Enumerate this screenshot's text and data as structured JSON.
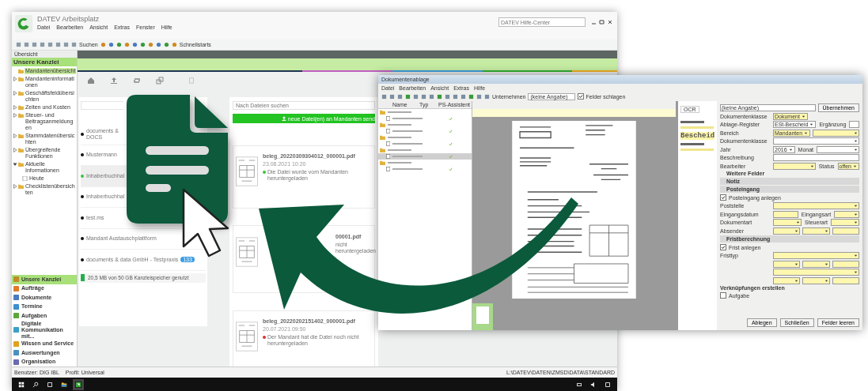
{
  "back_window": {
    "title": "DATEV Arbeitsplatz",
    "menu": [
      "Datei",
      "Bearbeiten",
      "Ansicht",
      "Extras",
      "Fenster",
      "Hilfe"
    ],
    "toolbar": {
      "search_label": "Suchen",
      "quick_label": "Schnellstarts"
    },
    "help_search": {
      "placeholder": "DATEV Hilfe-Center"
    },
    "sidebar": {
      "header": "Übersicht",
      "section": "Unsere Kanzlei",
      "tree": [
        {
          "label": "Mandantenübersicht",
          "selected": true
        },
        {
          "label": "Mandanteninformationen",
          "selected": false,
          "expanded": false
        },
        {
          "label": "Geschäftsfeldübersichten",
          "selected": false,
          "expanded": false
        },
        {
          "label": "Zeiten und Kosten",
          "selected": false,
          "expanded": false
        },
        {
          "label": "Steuer- und Beitragsanmeldungen",
          "selected": false,
          "expanded": false
        },
        {
          "label": "Stammdatenübersichten",
          "selected": false,
          "expanded": false
        },
        {
          "label": "Übergreifende Funktionen",
          "selected": false,
          "expanded": false
        },
        {
          "label": "Aktuelle Informationen",
          "selected": false,
          "expanded": true,
          "children": [
            {
              "label": "Heute",
              "selected": false
            }
          ]
        },
        {
          "label": "Checklistenübersichten",
          "selected": false,
          "expanded": false
        }
      ],
      "nav": [
        {
          "label": "Unsere Kanzlei",
          "selected": true,
          "color": "#c08a2a"
        },
        {
          "label": "Aufträge",
          "selected": false,
          "color": "#e07b2a"
        },
        {
          "label": "Dokumente",
          "selected": false,
          "color": "#4a7bbf"
        },
        {
          "label": "Termine",
          "selected": false,
          "color": "#3c8fd0"
        },
        {
          "label": "Aufgaben",
          "selected": false,
          "color": "#5aa83c"
        },
        {
          "label": "Digitale Kommunikation mit...",
          "selected": false,
          "color": "#3aa0c8"
        },
        {
          "label": "Wissen und Service",
          "selected": false,
          "color": "#e0a020"
        },
        {
          "label": "Auswertungen",
          "selected": false,
          "color": "#4a90c0"
        },
        {
          "label": "Organisation",
          "selected": false,
          "color": "#6a6ab0"
        }
      ]
    },
    "portal": {
      "clients": [
        {
          "name": "documents &",
          "sub": "DOCS",
          "selected": false
        },
        {
          "name": "Mustermann",
          "selected": false
        },
        {
          "name": "Inhaberbuchhal",
          "selected": true
        },
        {
          "name": "Inhaberbuchhal",
          "selected": false
        },
        {
          "name": "test.ms",
          "selected": false
        },
        {
          "name": "Mandant Austauschplattform",
          "selected": false
        },
        {
          "name": "documents & data GmbH - Testpraxis",
          "badge": "133",
          "selected": false
        }
      ],
      "storage": {
        "label": "20,5 MB von 50 GB Kanzleispeicher genutzt"
      },
      "file_search": {
        "placeholder": "Nach Dateien suchen"
      },
      "send_button": "neue Datei(en) an Mandanten send",
      "files": [
        {
          "name": "beleg_20220309304012_000001.pdf",
          "date": "23.08.2021 10:20",
          "status": "Die Datei wurde vom Mandanten heruntergeladen",
          "downloaded": true,
          "kind": "full"
        },
        {
          "name": "00001.pdf",
          "status": "nicht heruntergeladen",
          "kind": "partial"
        },
        {
          "name": "beleg_20220202151402_000001.pdf",
          "date": "20.07.2021 09:50",
          "status": "Der Mandant hat die Datei noch nicht heruntergeladen",
          "downloaded": false,
          "kind": "full"
        }
      ]
    },
    "status_bar": {
      "user": "Benutzer: DIG IBL",
      "profile": "Profil: Universal",
      "path": "L:\\DATEV\\DATEN\\ZMSD\\DATA\\STANDARD"
    }
  },
  "front_window": {
    "title": "Dokumentenablage",
    "menu": [
      "Datei",
      "Bearbeiten",
      "Ansicht",
      "Extras",
      "Hilfe"
    ],
    "toolbar": {
      "label": "Unternehmen",
      "value": "(keine Angabe)",
      "check_label": "Felder schlagen",
      "checked": true
    },
    "list": {
      "columns": [
        "Name",
        "Typ",
        "PS-Assistent"
      ],
      "rows": [
        {
          "kind": "folder",
          "selected": false
        },
        {
          "kind": "file",
          "selected": false
        },
        {
          "kind": "folder",
          "selected": false
        },
        {
          "kind": "file",
          "selected": false
        },
        {
          "kind": "folder",
          "selected": false
        },
        {
          "kind": "file",
          "selected": false
        },
        {
          "kind": "folder",
          "selected": false
        },
        {
          "kind": "file",
          "selected": true
        },
        {
          "kind": "folder",
          "selected": false
        },
        {
          "kind": "file",
          "selected": false
        }
      ]
    },
    "ocr": {
      "tab": "OCR",
      "highlight": "Bescheid"
    },
    "form": {
      "header_value": "(keine Angabe)",
      "apply_button": "Übernehmen",
      "rows": [
        {
          "kind": "row",
          "label": "Dokumentenklasse",
          "controls": [
            {
              "kind": "select",
              "value": "Dokument",
              "highlighted": true
            }
          ]
        },
        {
          "kind": "row",
          "label": "Ablage-Register",
          "controls": [
            {
              "kind": "select",
              "value": "ESt-Bescheid",
              "highlighted": false
            },
            {
              "kind": "label",
              "value": "Ergänzung"
            },
            {
              "kind": "field",
              "highlighted": false
            }
          ]
        },
        {
          "kind": "row",
          "label": "Bereich",
          "controls": [
            {
              "kind": "select",
              "value": "Mandanten",
              "highlighted": true
            },
            {
              "kind": "select",
              "highlighted": true
            }
          ]
        },
        {
          "kind": "row",
          "label": "Dokumentenklasse",
          "controls": [
            {
              "kind": "select",
              "highlighted": false
            }
          ]
        },
        {
          "kind": "row",
          "label": "Jahr",
          "controls": [
            {
              "kind": "select",
              "value": "2016",
              "highlighted": false
            },
            {
              "kind": "label",
              "value": "Monat"
            },
            {
              "kind": "select",
              "highlighted": false
            }
          ]
        },
        {
          "kind": "row",
          "label": "Beschreibung",
          "controls": [
            {
              "kind": "field",
              "highlighted": false
            }
          ]
        },
        {
          "kind": "row",
          "label": "Bearbeiter",
          "controls": [
            {
              "kind": "select",
              "highlighted": true
            },
            {
              "kind": "label",
              "value": "Status"
            },
            {
              "kind": "select",
              "value": "offen",
              "highlighted": true
            }
          ]
        },
        {
          "kind": "link",
          "label": "Weitere Felder"
        },
        {
          "kind": "section",
          "label": "Notiz"
        },
        {
          "kind": "section",
          "label": "Posteingang"
        },
        {
          "kind": "check",
          "label": "Posteingang anlegen",
          "checked": true
        },
        {
          "kind": "row",
          "label": "Poststelle",
          "controls": [
            {
              "kind": "select",
              "highlighted": true
            }
          ]
        },
        {
          "kind": "row",
          "label": "Eingangsdatum",
          "controls": [
            {
              "kind": "field",
              "highlighted": true
            },
            {
              "kind": "label",
              "value": "Eingangsart"
            },
            {
              "kind": "select",
              "highlighted": true
            }
          ]
        },
        {
          "kind": "row",
          "label": "Dokumentart",
          "controls": [
            {
              "kind": "select",
              "highlighted": true
            },
            {
              "kind": "label",
              "value": "Steuerart"
            },
            {
              "kind": "select",
              "highlighted": true
            }
          ]
        },
        {
          "kind": "row",
          "label": "Absender",
          "controls": [
            {
              "kind": "select",
              "highlighted": true
            },
            {
              "kind": "select",
              "highlighted": true
            },
            {
              "kind": "field",
              "highlighted": true
            }
          ]
        },
        {
          "kind": "section",
          "label": "Fristberechnung"
        },
        {
          "kind": "check",
          "label": "Frist anlegen",
          "checked": true
        },
        {
          "kind": "row",
          "label": "Fristtyp",
          "controls": [
            {
              "kind": "select",
              "highlighted": true
            }
          ]
        },
        {
          "kind": "row",
          "controls": [
            {
              "kind": "select",
              "highlighted": true
            },
            {
              "kind": "select",
              "highlighted": true
            },
            {
              "kind": "field",
              "highlighted": true
            }
          ]
        },
        {
          "kind": "row",
          "controls": [
            {
              "kind": "select",
              "highlighted": true
            }
          ]
        },
        {
          "kind": "row",
          "controls": [
            {
              "kind": "select",
              "highlighted": true
            },
            {
              "kind": "select",
              "highlighted": true
            },
            {
              "kind": "field",
              "highlighted": true
            }
          ]
        },
        {
          "kind": "heading",
          "label": "Verknüpfungen erstellen"
        },
        {
          "kind": "check",
          "label": "Aufgabe",
          "checked": false
        }
      ],
      "buttons": [
        "Ablegen",
        "Schließen",
        "Felder leeren"
      ]
    }
  }
}
